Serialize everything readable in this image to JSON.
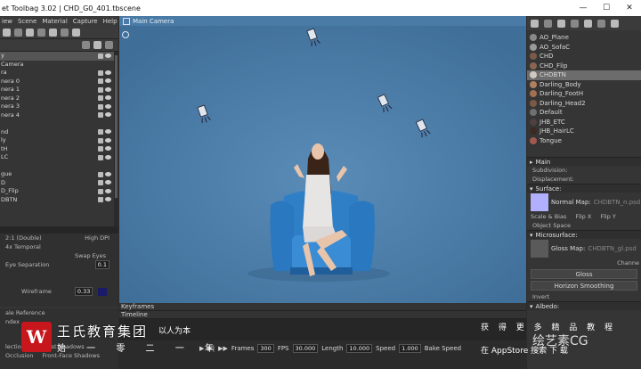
{
  "window": {
    "title": "et Toolbag 3.02  |  CHD_G0_401.tbscene",
    "min": "—",
    "max": "☐",
    "close": "✕"
  },
  "menu": [
    "iew",
    "Scene",
    "Material",
    "Capture",
    "Help"
  ],
  "scene_tree": {
    "header": "y",
    "items": [
      "Camera",
      "ra",
      "nera 0",
      "nera 1",
      "nera 2",
      "nera 3",
      "nera 4",
      "",
      "nd",
      "ly",
      "tH",
      "LC",
      "",
      "gue",
      "D",
      "D_Flip",
      "DBTN"
    ]
  },
  "left_settings": {
    "stereo_mode": "2:1 (Double)",
    "high_dpi": "High DPI",
    "temporal": "4x Temporal",
    "swap_eyes": "Swap Eyes",
    "eye_sep_label": "Eye Separation",
    "eye_sep_value": "0.1",
    "wireframe_label": "Wireframe",
    "wireframe_value": "0.33",
    "scale_ref": "ale Reference",
    "index": "ndex",
    "reflection": "lection",
    "rc_shadows": "Raycast Shadows",
    "occlusion": "Occlusion",
    "front_face": "Front-Face Shadows"
  },
  "viewport": {
    "camera_label": "Main Camera"
  },
  "materials": [
    {
      "name": "AO_Plane",
      "color": "#8a8a8a"
    },
    {
      "name": "AO_SofaC",
      "color": "#9a9a9a"
    },
    {
      "name": "CHD",
      "color": "#7a5a48"
    },
    {
      "name": "CHD_Flip",
      "color": "#8a6650"
    },
    {
      "name": "CHDBTN",
      "color": "#d0c8c0"
    },
    {
      "name": "Darling_Body",
      "color": "#b08060"
    },
    {
      "name": "Darling_FootH",
      "color": "#a07050"
    },
    {
      "name": "Darling_Head2",
      "color": "#7a5a44"
    },
    {
      "name": "Default",
      "color": "#707070"
    },
    {
      "name": "JHB_ETC",
      "color": "#504040"
    },
    {
      "name": "JHB_HairLC",
      "color": "#3a2a22"
    },
    {
      "name": "Tongue",
      "color": "#a05a50"
    }
  ],
  "props": {
    "main": "Main",
    "subdivision": "Subdivision:",
    "displacement": "Displacement:",
    "surface": "Surface:",
    "normal_map": "Normal Map:",
    "normal_map_file": "CHDBTN_n.psd",
    "scale_bias": "Scale & Bias",
    "flip_x": "Flip X",
    "flip_y": "Flip Y",
    "object_space": "Object Space",
    "microsurface": "Microsurface:",
    "gloss_map": "Gloss Map:",
    "gloss_map_file": "CHDBTN_gl.psd",
    "channel": "Channe",
    "gloss": "Gloss",
    "horizon": "Horizon Smoothing",
    "invert": "Invert",
    "albedo": "Albedo:"
  },
  "bottom": {
    "keyframes": "Keyframes",
    "timeline": "Timeline",
    "frames_label": "Frames",
    "frames_value": "300",
    "fps_label": "FPS",
    "fps_value": "30.000",
    "length_label": "Length",
    "length_value": "10.000",
    "speed_label": "Speed",
    "speed_value": "1.000",
    "bake_label": "Bake Speed"
  },
  "watermark": {
    "logo": "W",
    "org": "王氏教育集团",
    "slogan": "以人为本",
    "subline": "始 一 零 二 一 年",
    "right1": "获 得 更 多 精 品 教 程",
    "right2": "在 AppStore 搜索 下 载",
    "yuansu": "绘艺素CG"
  }
}
